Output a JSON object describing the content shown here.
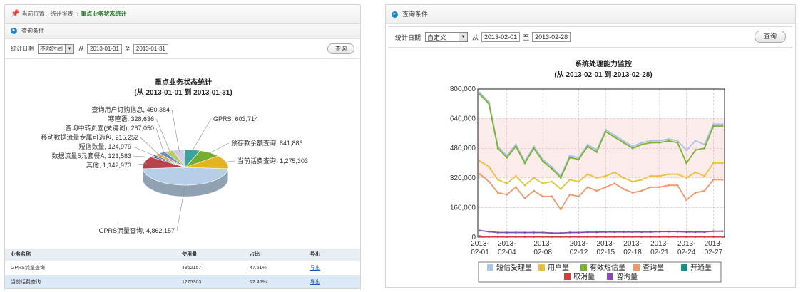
{
  "left_panel": {
    "breadcrumb": {
      "prefix": "当前位置：",
      "item1": "统计报表",
      "sep": "›",
      "current": "重点业务状态统计"
    },
    "query_title": "查询条件",
    "query": {
      "label": "统计日期",
      "select_value": "不限时间",
      "from_label": "从",
      "from_date": "2013-01-01",
      "to_label": "至",
      "to_date": "2013-01-31",
      "button": "查询"
    },
    "table": {
      "headers": [
        "业务名称",
        "使用量",
        "占比",
        "导出"
      ],
      "rows": [
        {
          "name": "GPRS流量查询",
          "usage": "4862157",
          "ratio": "47.51%",
          "export": "导出"
        },
        {
          "name": "当前话费查询",
          "usage": "1275303",
          "ratio": "12.46%",
          "export": "导出"
        }
      ]
    }
  },
  "right_panel": {
    "query_title": "查询条件",
    "query": {
      "label": "统计日期",
      "select_value": "自定义",
      "from_label": "从",
      "from_date": "2013-02-01",
      "to_label": "至",
      "to_date": "2013-02-28",
      "button": "查询"
    }
  },
  "chart_data": [
    {
      "type": "pie",
      "title": "重点业务状态统计",
      "subtitle": "(从 2013-01-01 到 2013-01-31)",
      "slices": [
        {
          "label": "GPRS流量查询, 4,862,157",
          "value": 4862157,
          "color": "#b7cfe6"
        },
        {
          "label": "其他, 1,142,973",
          "value": 1142973,
          "color": "#b8434a"
        },
        {
          "label": "数据流量5元套餐A, 121,583",
          "value": 121583,
          "color": "#5b3c87"
        },
        {
          "label": "短信数量, 124,979",
          "value": 124979,
          "color": "#2f8a8a"
        },
        {
          "label": "移动数据流量专属可选包, 215,252",
          "value": 215252,
          "color": "#e9a34a"
        },
        {
          "label": "查询中转页面(关键词), 267,050",
          "value": 267050,
          "color": "#6a8fc6"
        },
        {
          "label": "寒暄语, 328,636",
          "value": 328636,
          "color": "#b7c96a"
        },
        {
          "label": "查询用户订购信息, 450,384",
          "value": 450384,
          "color": "#d2cde8"
        },
        {
          "label": "GPRS, 603,714",
          "value": 603714,
          "color": "#3aa39e"
        },
        {
          "label": "预存款余额查询, 841,886",
          "value": 841886,
          "color": "#74ad2f"
        },
        {
          "label": "当前话费查询, 1,275,303",
          "value": 1275303,
          "color": "#e3b322"
        }
      ]
    },
    {
      "type": "line",
      "title": "系统处理能力监控",
      "subtitle": "(从 2013-02-01 到 2013-02-28)",
      "x": [
        "2013-02-01",
        "2013-02-02",
        "2013-02-03",
        "2013-02-04",
        "2013-02-05",
        "2013-02-06",
        "2013-02-07",
        "2013-02-08",
        "2013-02-09",
        "2013-02-10",
        "2013-02-11",
        "2013-02-12",
        "2013-02-13",
        "2013-02-14",
        "2013-02-15",
        "2013-02-16",
        "2013-02-17",
        "2013-02-18",
        "2013-02-19",
        "2013-02-20",
        "2013-02-21",
        "2013-02-22",
        "2013-02-23",
        "2013-02-24",
        "2013-02-25",
        "2013-02-26",
        "2013-02-27",
        "2013-02-28"
      ],
      "tick_labels": [
        {
          "index": 0,
          "line1": "2013-",
          "line2": "02-01"
        },
        {
          "index": 3,
          "line1": "2013-",
          "line2": "02-04"
        },
        {
          "index": 7,
          "line1": "2013-",
          "line2": "02-08"
        },
        {
          "index": 11,
          "line1": "2013-",
          "line2": "02-12"
        },
        {
          "index": 14,
          "line1": "2013-",
          "line2": "02-15"
        },
        {
          "index": 17,
          "line1": "2013-",
          "line2": "02-18"
        },
        {
          "index": 20,
          "line1": "2013-",
          "line2": "02-21"
        },
        {
          "index": 23,
          "line1": "2013-",
          "line2": "02-24"
        },
        {
          "index": 26,
          "line1": "2013-",
          "line2": "02-27"
        }
      ],
      "yticks": [
        "0",
        "160,000",
        "320,000",
        "480,000",
        "640,000",
        "800,000"
      ],
      "ylim": [
        0,
        800000
      ],
      "band": [
        320000,
        640000
      ],
      "series": [
        {
          "name": "短信受理量",
          "color": "#a9c4e4",
          "values": [
            780000,
            730000,
            490000,
            440000,
            500000,
            410000,
            490000,
            420000,
            380000,
            330000,
            440000,
            430000,
            500000,
            470000,
            580000,
            550000,
            520000,
            490000,
            510000,
            520000,
            520000,
            530000,
            520000,
            470000,
            520000,
            500000,
            610000,
            610000
          ]
        },
        {
          "name": "用户量",
          "color": "#e8c23a",
          "values": [
            410000,
            380000,
            310000,
            290000,
            330000,
            280000,
            320000,
            290000,
            300000,
            260000,
            310000,
            300000,
            340000,
            320000,
            330000,
            350000,
            320000,
            300000,
            310000,
            330000,
            330000,
            340000,
            340000,
            320000,
            350000,
            330000,
            400000,
            400000
          ]
        },
        {
          "name": "有效短信量",
          "color": "#7ab42f",
          "values": [
            770000,
            720000,
            480000,
            430000,
            490000,
            400000,
            480000,
            410000,
            370000,
            320000,
            430000,
            420000,
            490000,
            460000,
            570000,
            540000,
            510000,
            480000,
            500000,
            510000,
            510000,
            520000,
            510000,
            400000,
            470000,
            480000,
            600000,
            600000
          ]
        },
        {
          "name": "查询量",
          "color": "#f0976a",
          "values": [
            340000,
            300000,
            240000,
            230000,
            270000,
            210000,
            250000,
            220000,
            220000,
            150000,
            230000,
            220000,
            270000,
            250000,
            270000,
            290000,
            260000,
            240000,
            250000,
            270000,
            270000,
            280000,
            280000,
            200000,
            240000,
            250000,
            310000,
            310000
          ]
        },
        {
          "name": "开通量",
          "color": "#1a8e8a",
          "values": [
            5000,
            3000,
            3000,
            3000,
            3000,
            3000,
            3000,
            3000,
            3000,
            3000,
            3000,
            3000,
            3000,
            3000,
            3000,
            3000,
            3000,
            3000,
            3000,
            3000,
            3000,
            3000,
            3000,
            3000,
            3000,
            3000,
            3000,
            3000
          ]
        },
        {
          "name": "取消量",
          "color": "#d23c3c",
          "values": [
            3000,
            2000,
            2000,
            2000,
            2000,
            2000,
            2000,
            2000,
            2000,
            2000,
            2000,
            2000,
            2000,
            2000,
            2000,
            2000,
            2000,
            2000,
            2000,
            2000,
            2000,
            2000,
            2000,
            2000,
            2000,
            2000,
            2000,
            2000
          ]
        },
        {
          "name": "咨询量",
          "color": "#8a4aa8",
          "values": [
            35000,
            30000,
            25000,
            25000,
            25000,
            25000,
            25000,
            25000,
            22000,
            22000,
            25000,
            25000,
            27000,
            27000,
            28000,
            28000,
            28000,
            28000,
            28000,
            28000,
            30000,
            30000,
            30000,
            28000,
            28000,
            28000,
            32000,
            32000
          ]
        }
      ],
      "legend_placement": "bottom",
      "grid": true
    }
  ]
}
